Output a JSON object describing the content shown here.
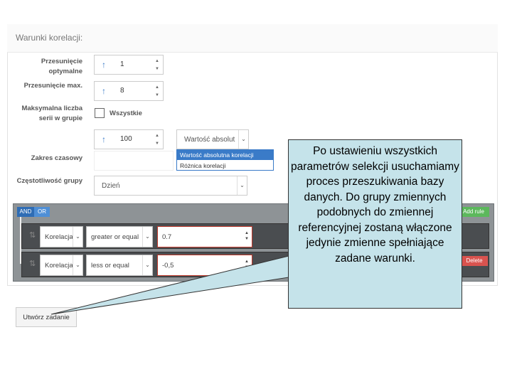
{
  "panel": {
    "title": "Warunki korelacji:"
  },
  "fields": {
    "offset_optimal": {
      "label": "Przesunięcie optymalne",
      "value": "1"
    },
    "offset_max": {
      "label": "Przesunięcie max.",
      "value": "8"
    },
    "max_series": {
      "label": "Maksymalna liczba serii w grupie",
      "checkbox_label": "Wszystkie",
      "checked": false
    },
    "time_range": {
      "label": "Zakres czasowy",
      "value": "100",
      "select_value": "Wartość absolut",
      "options": [
        "Wartość absolutna korelacji",
        "Różnica korelacji"
      ]
    },
    "group_frequency": {
      "label": "Częstotliwość grupy",
      "value": "Dzień"
    }
  },
  "query_builder": {
    "and_label": "AND",
    "or_label": "OR",
    "add_rule_label": "Add rule",
    "delete_label": "Delete",
    "rules": [
      {
        "field": "Korelacja",
        "operator": "greater or equal",
        "value": "0.7"
      },
      {
        "field": "Korelacja",
        "operator": "less or equal",
        "value": "-0,5"
      }
    ]
  },
  "submit_label": "Utwórz zadanie",
  "callout": {
    "text": "Po ustawieniu wszystkich parametrów selekcji usuchamiamy proces przeszukiwania bazy danych. Do grupy zmiennych podobnych do zmiennej referencyjnej zostaną włączone jedynie zmienne spełniające zadane warunki."
  },
  "colors": {
    "accent": "#3a7bc8",
    "callout_bg": "#c5e3ea",
    "add_rule": "#5cb85c",
    "delete": "#d9534f",
    "query_bg": "#8e9396"
  }
}
